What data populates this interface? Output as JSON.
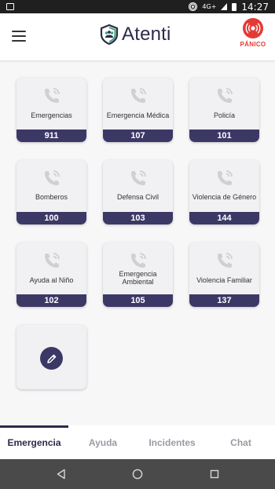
{
  "status_bar": {
    "network": "4G+",
    "time": "14:27"
  },
  "app": {
    "title": "Atenti",
    "panic_label": "PÁNICO",
    "menu_icon": "hamburger-menu-icon",
    "logo_icon": "atenti-shield-logo-icon",
    "panic_icon": "panic-broadcast-icon"
  },
  "colors": {
    "accent": "#3c3866",
    "panic": "#e53935",
    "text_dark": "#2d2a4a",
    "tab_inactive": "#9a9aa3",
    "card_bg": "#f1f1f3"
  },
  "emergency_contacts": [
    {
      "label": "Emergencias",
      "number": "911",
      "icon": "phone-call-icon"
    },
    {
      "label": "Emergencia Médica",
      "number": "107",
      "icon": "phone-call-icon"
    },
    {
      "label": "Policía",
      "number": "101",
      "icon": "phone-call-icon"
    },
    {
      "label": "Bomberos",
      "number": "100",
      "icon": "phone-call-icon"
    },
    {
      "label": "Defensa Civil",
      "number": "103",
      "icon": "phone-call-icon"
    },
    {
      "label": "Violencia de Género",
      "number": "144",
      "icon": "phone-call-icon"
    },
    {
      "label": "Ayuda al Niño",
      "number": "102",
      "icon": "phone-call-icon"
    },
    {
      "label": "Emergencia Ambiental",
      "number": "105",
      "icon": "phone-call-icon"
    },
    {
      "label": "Violencia Familiar",
      "number": "137",
      "icon": "phone-call-icon"
    }
  ],
  "edit_card": {
    "icon": "pencil-edit-icon"
  },
  "tabs": [
    {
      "label": "Emergencia",
      "active": true
    },
    {
      "label": "Ayuda",
      "active": false
    },
    {
      "label": "Incidentes",
      "active": false
    },
    {
      "label": "Chat",
      "active": false
    }
  ],
  "nav_bar": {
    "back_icon": "nav-back-icon",
    "home_icon": "nav-home-icon",
    "recents_icon": "nav-recents-icon"
  }
}
